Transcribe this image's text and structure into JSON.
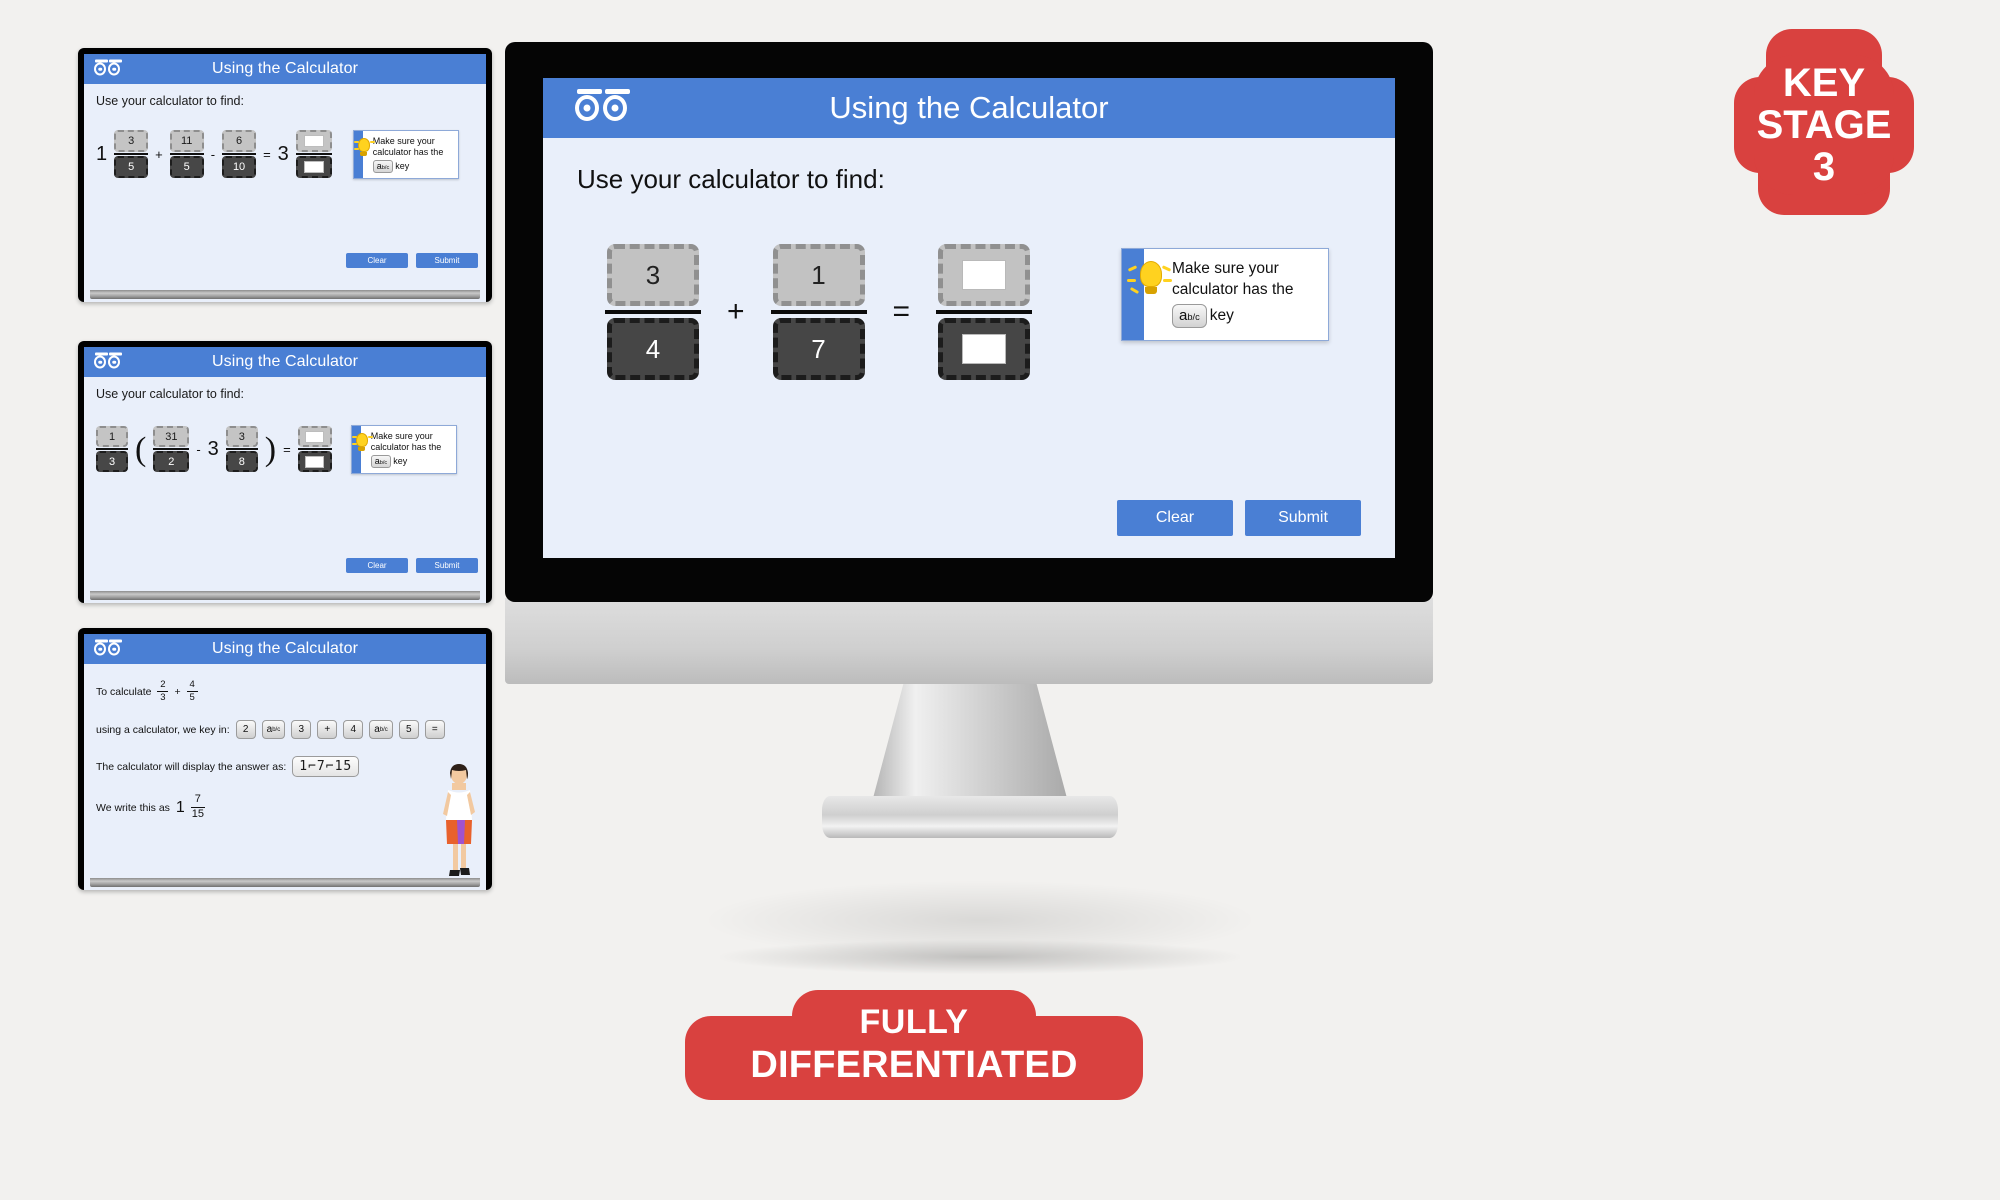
{
  "app": {
    "title": "Using the Calculator",
    "logo_icon": "binocular-eyes-logo-icon"
  },
  "badges": {
    "key_stage": {
      "line1": "KEY",
      "line2": "STAGE",
      "line3": "3",
      "color": "#d9413f"
    },
    "differentiated": {
      "line1": "FULLY",
      "line2": "DIFFERENTIATED",
      "color": "#d9413f"
    }
  },
  "theme": {
    "accent_blue": "#4a7fd4",
    "screen_bg": "#e9effa",
    "numerator_grey": "#c2c2c2",
    "denominator_dark": "#464646",
    "badge_red": "#d9413f"
  },
  "main_slide": {
    "title": "Using the Calculator",
    "prompt": "Use your calculator to find:",
    "expression": {
      "terms": [
        {
          "type": "fraction",
          "numerator": "3",
          "denominator": "4"
        },
        {
          "type": "operator",
          "symbol": "+"
        },
        {
          "type": "fraction",
          "numerator": "1",
          "denominator": "7"
        },
        {
          "type": "operator",
          "symbol": "="
        },
        {
          "type": "fraction",
          "numerator": "",
          "denominator": "",
          "blank": true
        }
      ]
    },
    "hint": {
      "line1": "Make sure your",
      "line2": "calculator has the",
      "key_base": "a",
      "key_sup": "b/c",
      "line3_tail": "key",
      "icon": "lightbulb-icon"
    },
    "buttons": {
      "clear": "Clear",
      "submit": "Submit"
    }
  },
  "thumb1": {
    "title": "Using the Calculator",
    "prompt": "Use your calculator to find:",
    "whole_left": "1",
    "terms": [
      {
        "type": "fraction",
        "numerator": "3",
        "denominator": "5"
      },
      {
        "type": "operator",
        "symbol": "+"
      },
      {
        "type": "fraction",
        "numerator": "11",
        "denominator": "5"
      },
      {
        "type": "operator",
        "symbol": "-"
      },
      {
        "type": "fraction",
        "numerator": "6",
        "denominator": "10"
      },
      {
        "type": "operator",
        "symbol": "="
      }
    ],
    "result_whole": "3",
    "hint": {
      "line1": "Make sure your",
      "line2": "calculator has the",
      "key_base": "a",
      "key_sup": "b/c",
      "line3_tail": "key"
    },
    "buttons": {
      "clear": "Clear",
      "submit": "Submit"
    }
  },
  "thumb2": {
    "title": "Using the Calculator",
    "prompt": "Use your calculator to find:",
    "terms": [
      {
        "type": "fraction",
        "numerator": "1",
        "denominator": "3"
      },
      {
        "type": "paren",
        "symbol": "("
      },
      {
        "type": "fraction",
        "numerator": "31",
        "denominator": "2"
      },
      {
        "type": "operator",
        "symbol": "-"
      },
      {
        "type": "whole",
        "value": "3"
      },
      {
        "type": "fraction",
        "numerator": "3",
        "denominator": "8"
      },
      {
        "type": "paren",
        "symbol": ")"
      },
      {
        "type": "operator",
        "symbol": "="
      }
    ],
    "hint": {
      "line1": "Make sure your",
      "line2": "calculator has the",
      "key_base": "a",
      "key_sup": "b/c",
      "line3_tail": "key"
    },
    "buttons": {
      "clear": "Clear",
      "submit": "Submit"
    }
  },
  "thumb3": {
    "title": "Using the Calculator",
    "line1_label": "To calculate",
    "line1_frac_a": {
      "numerator": "2",
      "denominator": "3"
    },
    "line1_op": "+",
    "line1_frac_b": {
      "numerator": "4",
      "denominator": "5"
    },
    "line2_label": "using a calculator, we key in:",
    "keys": [
      {
        "base": "2",
        "sup": ""
      },
      {
        "base": "a",
        "sup": "b/c"
      },
      {
        "base": "3",
        "sup": ""
      },
      {
        "base": "+",
        "sup": ""
      },
      {
        "base": "4",
        "sup": ""
      },
      {
        "base": "a",
        "sup": "b/c"
      },
      {
        "base": "5",
        "sup": ""
      },
      {
        "base": "=",
        "sup": ""
      }
    ],
    "line3_label": "The calculator will display the answer as:",
    "lcd_value": "1⌐7⌐15",
    "line4_label": "We write this as",
    "answer_whole": "1",
    "answer_frac": {
      "numerator": "7",
      "denominator": "15"
    },
    "teacher_icon": "teacher-figure-icon"
  }
}
